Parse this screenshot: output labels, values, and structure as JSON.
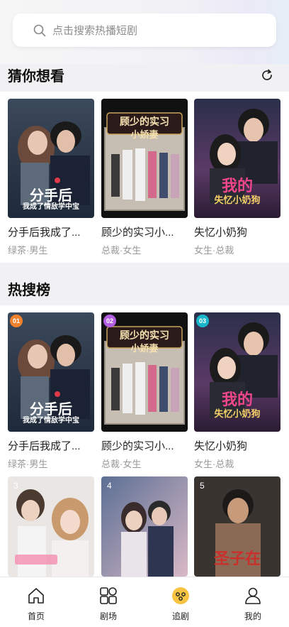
{
  "search": {
    "placeholder": "点击搜索热播短剧"
  },
  "guess": {
    "title": "猜你想看",
    "items": [
      {
        "title": "分手后我成了...",
        "tags": "绿茶·男生",
        "poster_text": "分手后",
        "poster_sub": "我成了情敌学中宝"
      },
      {
        "title": "顾少的实习小...",
        "tags": "总裁·女生",
        "poster_text": "顾少的实习",
        "poster_sub": "小娇妻"
      },
      {
        "title": "失忆小奶狗",
        "tags": "女生·总裁",
        "poster_text": "我的",
        "poster_sub": "失忆小奶狗"
      }
    ]
  },
  "hot": {
    "title": "热搜榜",
    "items": [
      {
        "rank": "01",
        "title": "分手后我成了...",
        "tags": "绿茶·男生",
        "poster_text": "分手后",
        "poster_sub": "我成了情敌学中宝"
      },
      {
        "rank": "02",
        "title": "顾少的实习小...",
        "tags": "总裁·女生",
        "poster_text": "顾少的实习",
        "poster_sub": "小娇妻"
      },
      {
        "rank": "03",
        "title": "失忆小奶狗",
        "tags": "女生·总裁",
        "poster_text": "我的",
        "poster_sub": "失忆小奶狗"
      },
      {
        "rank": "3",
        "poster_text": ""
      },
      {
        "rank": "4",
        "poster_text": ""
      },
      {
        "rank": "5",
        "poster_text": "圣子在"
      }
    ]
  },
  "nav": [
    {
      "label": "首页",
      "icon": "home-icon"
    },
    {
      "label": "剧场",
      "icon": "theater-icon"
    },
    {
      "label": "追剧",
      "icon": "follow-icon",
      "active": true
    },
    {
      "label": "我的",
      "icon": "profile-icon"
    }
  ],
  "colors": {
    "rank1": "#f0812d",
    "rank2": "#b35de0",
    "rank3": "#19b6c9",
    "active_nav": "#f6c343"
  }
}
